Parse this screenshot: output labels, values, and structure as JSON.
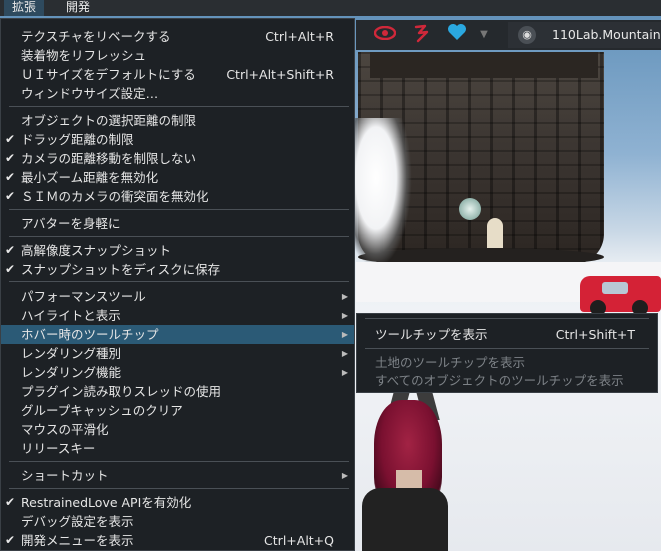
{
  "menubar": {
    "items": [
      {
        "label": "拡張",
        "active": true
      },
      {
        "label": "開発",
        "active": false
      }
    ]
  },
  "toolbar": {
    "icons": [
      "eye-icon",
      "gesture-icon",
      "heart-icon",
      "dropdown-arrow-icon"
    ],
    "location_icon": "globe-icon",
    "location_text": "110Lab.Mountain"
  },
  "menu": {
    "items": [
      {
        "label": "テクスチャをリベークする",
        "shortcut": "Ctrl+Alt+R",
        "checked": false
      },
      {
        "label": "装着物をリフレッシュ",
        "shortcut": "",
        "checked": false
      },
      {
        "label": "ＵＩサイズをデフォルトにする",
        "shortcut": "Ctrl+Alt+Shift+R",
        "checked": false
      },
      {
        "label": "ウィンドウサイズ設定…",
        "shortcut": "",
        "checked": false
      },
      {
        "label": "オブジェクトの選択距離の制限",
        "shortcut": "",
        "checked": false
      },
      {
        "label": "ドラッグ距離の制限",
        "shortcut": "",
        "checked": true
      },
      {
        "label": "カメラの距離移動を制限しない",
        "shortcut": "",
        "checked": true
      },
      {
        "label": "最小ズーム距離を無効化",
        "shortcut": "",
        "checked": true
      },
      {
        "label": "ＳＩＭのカメラの衝突面を無効化",
        "shortcut": "",
        "checked": true
      },
      {
        "label": "アバターを身軽に",
        "shortcut": "",
        "checked": false
      },
      {
        "label": "高解像度スナップショット",
        "shortcut": "",
        "checked": true
      },
      {
        "label": "スナップショットをディスクに保存",
        "shortcut": "",
        "checked": true
      },
      {
        "label": "パフォーマンスツール",
        "shortcut": "",
        "checked": false,
        "submenu": true
      },
      {
        "label": "ハイライトと表示",
        "shortcut": "",
        "checked": false,
        "submenu": true
      },
      {
        "label": "ホバー時のツールチップ",
        "shortcut": "",
        "checked": false,
        "submenu": true,
        "highlighted": true
      },
      {
        "label": "レンダリング種別",
        "shortcut": "",
        "checked": false,
        "submenu": true
      },
      {
        "label": "レンダリング機能",
        "shortcut": "",
        "checked": false,
        "submenu": true
      },
      {
        "label": "プラグイン読み取りスレッドの使用",
        "shortcut": "",
        "checked": false
      },
      {
        "label": "グループキャッシュのクリア",
        "shortcut": "",
        "checked": false
      },
      {
        "label": "マウスの平滑化",
        "shortcut": "",
        "checked": false
      },
      {
        "label": "リリースキー",
        "shortcut": "",
        "checked": false
      },
      {
        "label": "ショートカット",
        "shortcut": "",
        "checked": false,
        "submenu": true
      },
      {
        "label": "RestrainedLove APIを有効化",
        "shortcut": "",
        "checked": true
      },
      {
        "label": "デバッグ設定を表示",
        "shortcut": "",
        "checked": false
      },
      {
        "label": "開発メニューを表示",
        "shortcut": "Ctrl+Alt+Q",
        "checked": true
      }
    ],
    "check_glyph": "✔",
    "arrow_glyph": "▶"
  },
  "submenu": {
    "items": [
      {
        "label": "ツールチップを表示",
        "shortcut": "Ctrl+Shift+T",
        "disabled": false
      },
      {
        "label": "土地のツールチップを表示",
        "shortcut": "",
        "disabled": true
      },
      {
        "label": "すべてのオブジェクトのツールチップを表示",
        "shortcut": "",
        "disabled": true
      }
    ]
  },
  "colors": {
    "menu_bg": "#1d2125",
    "highlight": "#2b5a76",
    "eye": "#d0283a",
    "gesture": "#d0283a",
    "heart": "#2aa8e0"
  }
}
